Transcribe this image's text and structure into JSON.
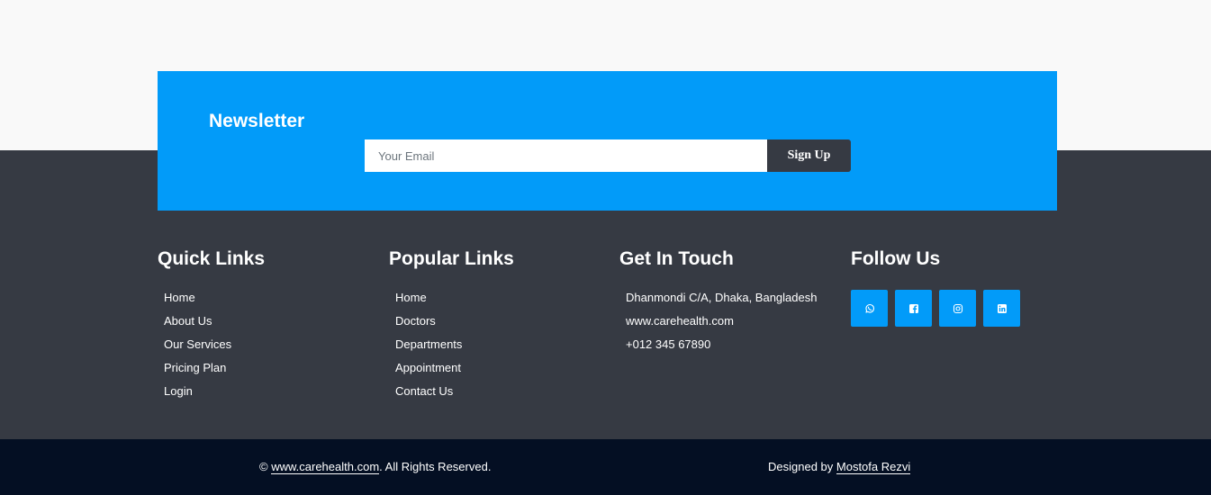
{
  "newsletter": {
    "title": "Newsletter",
    "email_placeholder": "Your Email",
    "signup_label": "Sign Up"
  },
  "quick_links": {
    "title": "Quick Links",
    "items": [
      "Home",
      "About Us",
      "Our Services",
      "Pricing Plan",
      "Login"
    ]
  },
  "popular_links": {
    "title": "Popular Links",
    "items": [
      "Home",
      "Doctors",
      "Departments",
      "Appointment",
      "Contact Us"
    ]
  },
  "contact": {
    "title": "Get In Touch",
    "address": "Dhanmondi C/A, Dhaka, Bangladesh",
    "website": "www.carehealth.com",
    "phone": "+012 345 67890"
  },
  "follow": {
    "title": "Follow Us",
    "icons": [
      "whatsapp-icon",
      "facebook-icon",
      "instagram-icon",
      "linkedin-icon"
    ]
  },
  "copyright": {
    "symbol": "© ",
    "site_link": "www.carehealth.com",
    "rights": ". All Rights Reserved."
  },
  "credit": {
    "prefix": "Designed by ",
    "designer": "Mostofa Rezvi"
  },
  "colors": {
    "accent": "#029bf9",
    "footer": "#363a43",
    "bottom_bar": "#040f23",
    "background": "#f9f9f9"
  }
}
